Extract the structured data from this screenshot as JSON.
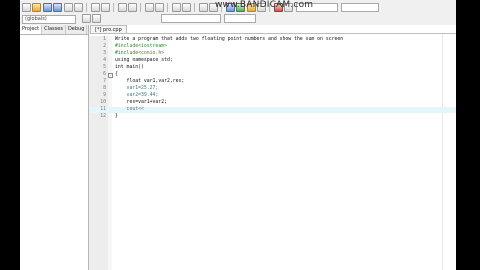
{
  "watermark": "www.BANDICAM.com",
  "class_combo": "(globals)",
  "left_panel": {
    "tabs": [
      "Project",
      "Classes",
      "Debug"
    ]
  },
  "editor": {
    "file_tab": "[*] pro.cpp",
    "lines": [
      {
        "n": "1",
        "text": "Write a program that adds two floating point numbers and show the sum on screen"
      },
      {
        "n": "2",
        "text": "#include<iostream>"
      },
      {
        "n": "3",
        "text": "#include<conio.h>"
      },
      {
        "n": "4",
        "text": "using namespace std;"
      },
      {
        "n": "5",
        "text": "int main()"
      },
      {
        "n": "6",
        "text": "{"
      },
      {
        "n": "7",
        "text": "    float var1,var2,res;"
      },
      {
        "n": "8",
        "text": "    var1=25.27;"
      },
      {
        "n": "9",
        "text": "    var2=39.44;"
      },
      {
        "n": "10",
        "text": "    res=var1+var2;"
      },
      {
        "n": "11",
        "text": "    cout<<"
      },
      {
        "n": "12",
        "text": "}"
      }
    ]
  },
  "colors": {
    "current_line": "#e3f7fb",
    "preprocessor": "#2f8a2f",
    "number": "#3a7a84"
  }
}
